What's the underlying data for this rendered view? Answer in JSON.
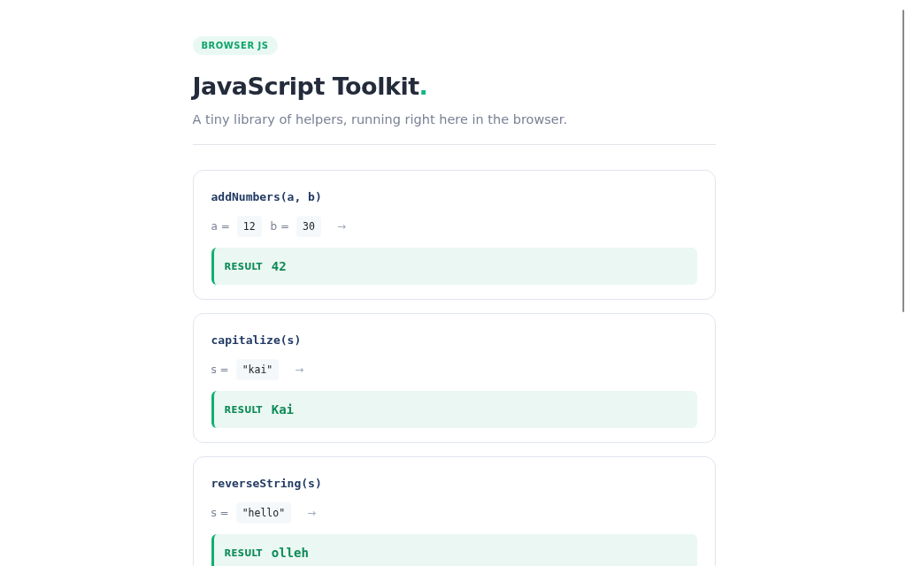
{
  "badge": "BROWSER JS",
  "title": {
    "text": "JavaScript Toolkit",
    "accent": "."
  },
  "subtitle": "A tiny library of helpers, running right here in the browser.",
  "functions": [
    {
      "signature": "addNumbers(a, b)",
      "args": [
        {
          "label": "a =",
          "value": "12"
        },
        {
          "label": "b =",
          "value": "30"
        }
      ],
      "arrow": "→",
      "result_label": "RESULT",
      "result": "42"
    },
    {
      "signature": "capitalize(s)",
      "args": [
        {
          "label": "s =",
          "value": "\"kai\""
        }
      ],
      "arrow": "→",
      "result_label": "RESULT",
      "result": "Kai"
    },
    {
      "signature": "reverseString(s)",
      "args": [
        {
          "label": "s =",
          "value": "\"hello\""
        }
      ],
      "arrow": "→",
      "result_label": "RESULT",
      "result": "olleh"
    }
  ]
}
